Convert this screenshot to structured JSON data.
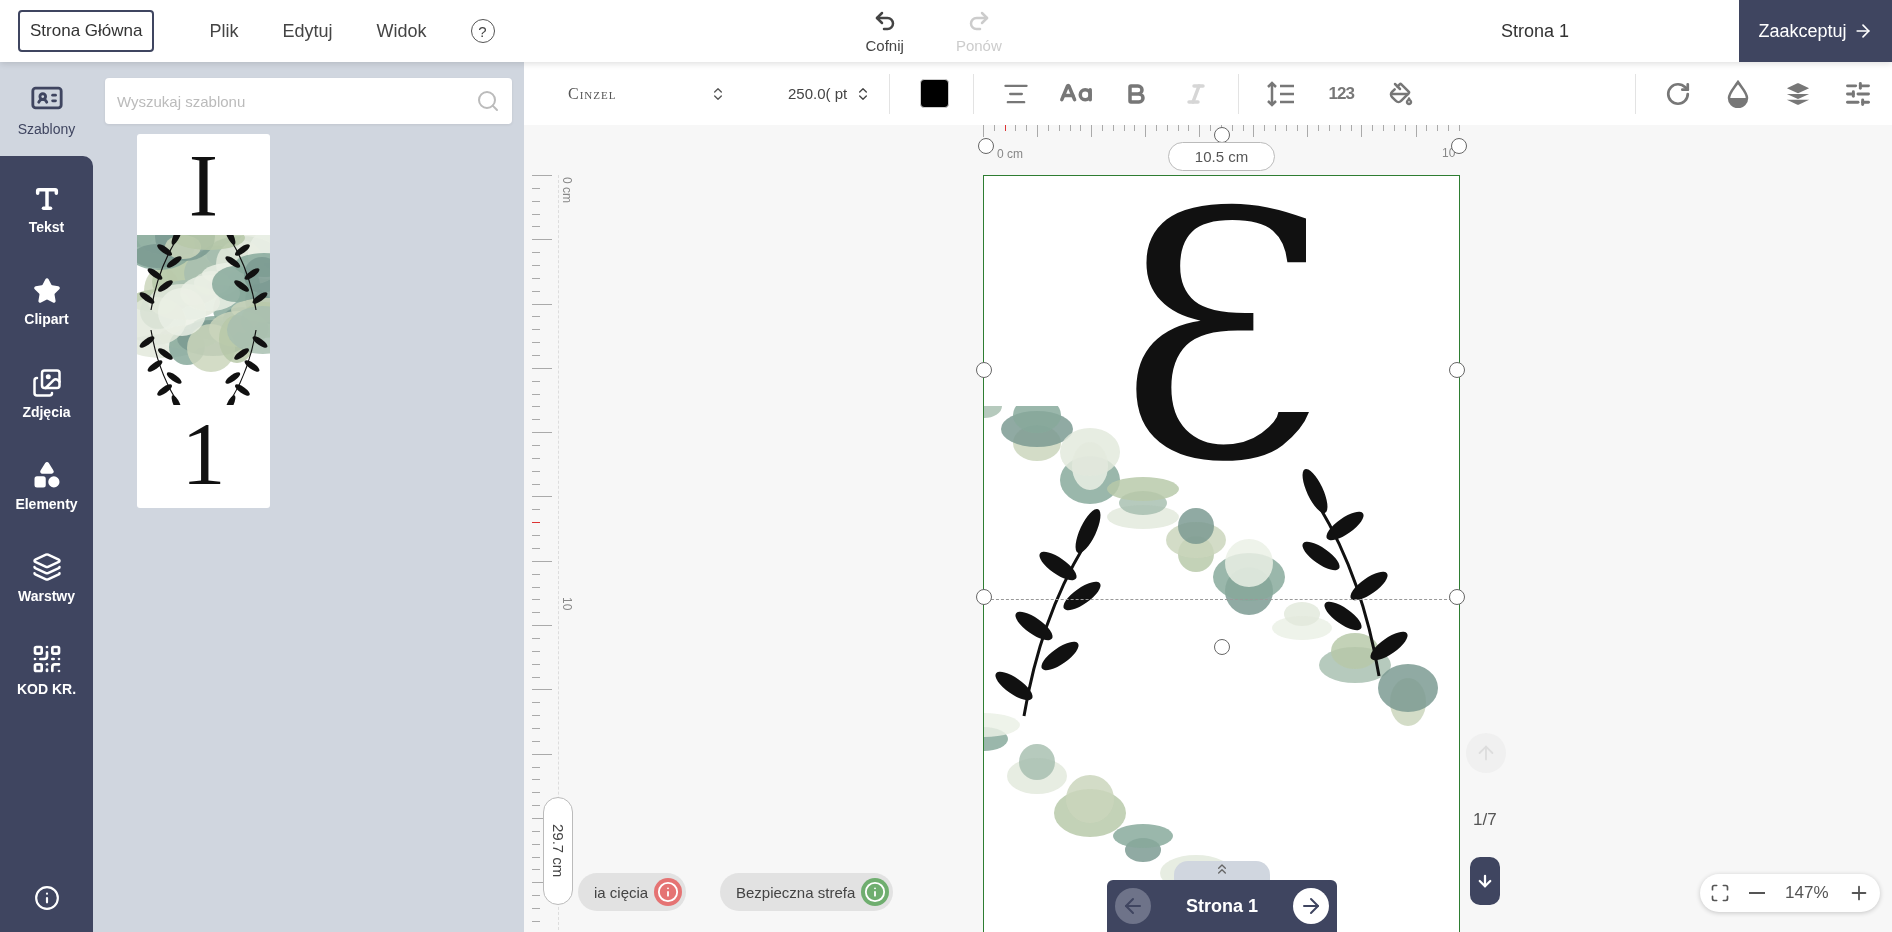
{
  "topbar": {
    "home_button": "Strona Główna",
    "menu": [
      "Plik",
      "Edytuj",
      "Widok",
      "?"
    ],
    "history": [
      {
        "kind": "undo",
        "label": "Cofnij",
        "disabled": false
      },
      {
        "kind": "redo",
        "label": "Ponów",
        "disabled": true
      }
    ],
    "page_title": "Strona 1",
    "accept_button": "Zaakceptuj"
  },
  "sidebar": {
    "items": [
      {
        "kind": "templates",
        "label": "Szablony",
        "selected": true
      },
      {
        "kind": "text",
        "label": "Tekst",
        "selected": false
      },
      {
        "kind": "clipart",
        "label": "Clipart",
        "selected": false
      },
      {
        "kind": "photos",
        "label": "Zdjęcia",
        "selected": false
      },
      {
        "kind": "elements",
        "label": "Elementy",
        "selected": false
      },
      {
        "kind": "layers",
        "label": "Warstwy",
        "selected": false
      },
      {
        "kind": "qr",
        "label": "KOD KR.",
        "selected": false
      }
    ]
  },
  "templates_panel": {
    "search": {
      "placeholder": "Wyszukaj szablonu"
    },
    "templates": [
      {
        "top_text": "I",
        "bottom_text": "1"
      }
    ]
  },
  "toolbar": {
    "font": "Cinzel",
    "size": "250.0(",
    "unit": "pt",
    "swatches": [
      {
        "color": "#000000"
      }
    ],
    "tools": [
      {
        "kind": "align",
        "disabled": false
      },
      {
        "kind": "case",
        "disabled": false
      },
      {
        "kind": "bold",
        "disabled": false
      },
      {
        "kind": "italic",
        "disabled": true
      },
      {
        "kind": "line_spacing",
        "disabled": false
      },
      {
        "kind": "numbers",
        "label": "123",
        "disabled": false
      },
      {
        "kind": "fill",
        "disabled": false
      }
    ],
    "right_tools": [
      {
        "kind": "rotate"
      },
      {
        "kind": "opacity"
      },
      {
        "kind": "layers"
      },
      {
        "kind": "adjust"
      }
    ]
  },
  "canvas": {
    "ruler_top": {
      "start": "0 cm",
      "width": "10.5 cm",
      "end": "10"
    },
    "ruler_left": {
      "start": "0 cm",
      "mid": "10",
      "height": "29.7 cm"
    },
    "page": {
      "letter": "Ɛ"
    },
    "guides": [
      {
        "label": "ia cięcia",
        "color": "#e57373"
      },
      {
        "label": "Bezpieczna strefa",
        "color": "#6fae6f"
      }
    ],
    "page_nav": {
      "label": "Strona 1",
      "prev_disabled": true,
      "next_disabled": false
    },
    "page_counter": "1/7",
    "zoom": "147%"
  }
}
